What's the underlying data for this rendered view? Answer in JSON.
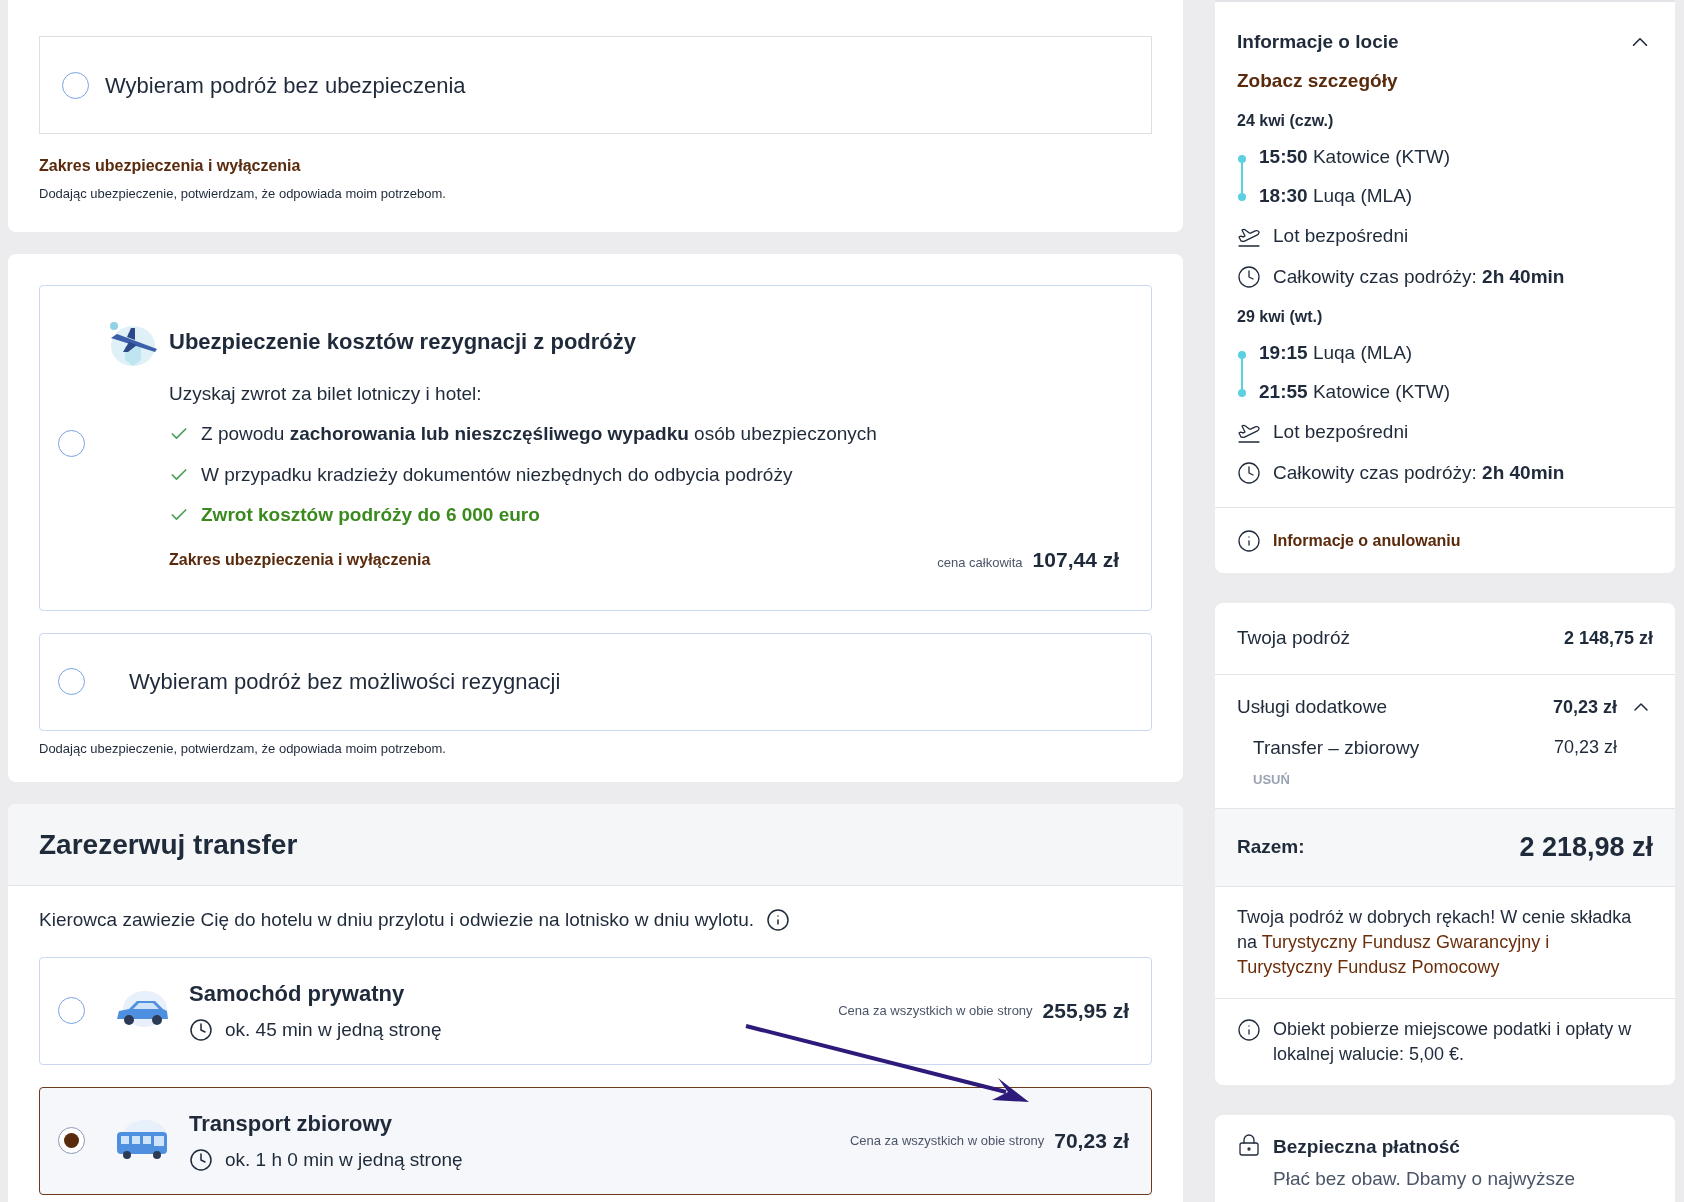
{
  "insurance_card_top": {
    "options": [
      {
        "label": "Wybieram podróż bez ubezpieczenia",
        "selected": false
      }
    ],
    "link": "Zakres ubezpieczenia i wyłączenia",
    "note": "Dodając ubezpieczenie, potwierdzam, że odpowiada moim potrzebom."
  },
  "cancellation_insurance": {
    "options": [
      {
        "kind": "offer",
        "selected": false,
        "title": "Ubezpieczenie kosztów rezygnacji z podróży",
        "intro": "Uzyskaj zwrot za bilet lotniczy i hotel:",
        "benefits": [
          {
            "text": "Z powodu **zachorowania lub nieszczęśliwego wypadku** osób ubezpieczonych",
            "highlight": false
          },
          {
            "text": "W przypadku kradzieży dokumentów niezbędnych do odbycia podróży",
            "highlight": false
          },
          {
            "text": "Zwrot kosztów podróży do 6 000 euro",
            "highlight": true
          }
        ],
        "link": "Zakres ubezpieczenia i wyłączenia",
        "price_label": "cena całkowita",
        "price": "107,44 zł"
      },
      {
        "kind": "plain",
        "selected": false,
        "label": "Wybieram podróż bez możliwości rezygnacji"
      }
    ],
    "note": "Dodając ubezpieczenie, potwierdzam, że odpowiada moim potrzebom."
  },
  "transfer": {
    "title": "Zarezerwuj transfer",
    "description": "Kierowca zawiezie Cię do hotelu w dniu przylotu i odwiezie na lotnisko w dniu wylotu.",
    "options": [
      {
        "kind": "car",
        "selected": false,
        "name": "Samochód prywatny",
        "duration": "ok. 45 min w jedną stronę",
        "price_label": "Cena za wszystkich w obie strony",
        "price": "255,95 zł"
      },
      {
        "kind": "bus",
        "selected": true,
        "name": "Transport zbiorowy",
        "duration": "ok. 1 h 0 min w jedną stronę",
        "price_label": "Cena za wszystkich w obie strony",
        "price": "70,23 zł"
      }
    ]
  },
  "flight_info": {
    "title": "Informacje o locie",
    "expanded": true,
    "details_link": "Zobacz szczegóły",
    "legs": [
      {
        "date": "24 kwi (czw.)",
        "stops": [
          "**15:50** Katowice (KTW)",
          "**18:30** Luqa (MLA)"
        ],
        "flight_type": "Lot bezpośredni",
        "duration": "Całkowity czas podróży: **2h 40min**"
      },
      {
        "date": "29 kwi (wt.)",
        "stops": [
          "**19:15** Luqa (MLA)",
          "**21:55** Katowice (KTW)"
        ],
        "flight_type": "Lot bezpośredni",
        "duration": "Całkowity czas podróży: **2h 40min**"
      }
    ],
    "cancellation_link": "Informacje o anulowaniu"
  },
  "summary": {
    "trip_label": "Twoja podróż",
    "trip_price": "2 148,75 zł",
    "extras_label": "Usługi dodatkowe",
    "extras_price": "70,23 zł",
    "extras_expanded": true,
    "extras": [
      {
        "name": "Transfer – zbiorowy",
        "price": "70,23 zł",
        "remove": "USUŃ"
      }
    ],
    "total_label": "Razem:",
    "total": "2 218,98 zł",
    "guarantee_text": "Twoja podróż w dobrych rękach! W cenie składka na",
    "guarantee_links": [
      "Turystyczny Fundusz Gwarancyjny i",
      "Turystyczny Fundusz Pomocowy"
    ],
    "tax_note": "Obiekt pobierze miejscowe podatki i opłaty w lokalnej walucie: 5,00 €."
  },
  "secure_payment": {
    "title": "Bezpieczna płatność",
    "text": "Płać bez obaw. Dbamy o najwyższe"
  }
}
